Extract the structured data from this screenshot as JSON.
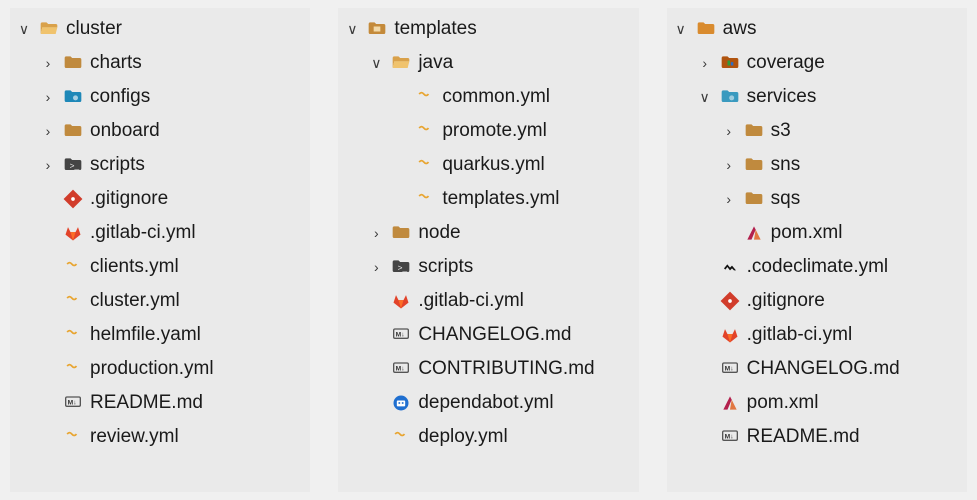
{
  "panels": [
    {
      "items": [
        {
          "indent": 0,
          "chev": "down",
          "icon": "folder-open",
          "label": "cluster"
        },
        {
          "indent": 1,
          "chev": "right",
          "icon": "folder",
          "label": "charts"
        },
        {
          "indent": 1,
          "chev": "right",
          "icon": "folder-config",
          "label": "configs"
        },
        {
          "indent": 1,
          "chev": "right",
          "icon": "folder",
          "label": "onboard"
        },
        {
          "indent": 1,
          "chev": "right",
          "icon": "folder-scripts",
          "label": "scripts"
        },
        {
          "indent": 1,
          "chev": "none",
          "icon": "gitignore",
          "label": ".gitignore"
        },
        {
          "indent": 1,
          "chev": "none",
          "icon": "gitlab",
          "label": ".gitlab-ci.yml"
        },
        {
          "indent": 1,
          "chev": "none",
          "icon": "yml",
          "label": "clients.yml"
        },
        {
          "indent": 1,
          "chev": "none",
          "icon": "yml",
          "label": "cluster.yml"
        },
        {
          "indent": 1,
          "chev": "none",
          "icon": "yml",
          "label": "helmfile.yaml"
        },
        {
          "indent": 1,
          "chev": "none",
          "icon": "yml",
          "label": "production.yml"
        },
        {
          "indent": 1,
          "chev": "none",
          "icon": "md",
          "label": "README.md"
        },
        {
          "indent": 1,
          "chev": "none",
          "icon": "yml",
          "label": "review.yml"
        }
      ]
    },
    {
      "items": [
        {
          "indent": 0,
          "chev": "down",
          "icon": "folder-templates",
          "label": "templates"
        },
        {
          "indent": 1,
          "chev": "down",
          "icon": "folder-open",
          "label": "java"
        },
        {
          "indent": 2,
          "chev": "none",
          "icon": "yml",
          "label": "common.yml"
        },
        {
          "indent": 2,
          "chev": "none",
          "icon": "yml",
          "label": "promote.yml"
        },
        {
          "indent": 2,
          "chev": "none",
          "icon": "yml",
          "label": "quarkus.yml"
        },
        {
          "indent": 2,
          "chev": "none",
          "icon": "yml",
          "label": "templates.yml"
        },
        {
          "indent": 1,
          "chev": "right",
          "icon": "folder",
          "label": "node"
        },
        {
          "indent": 1,
          "chev": "right",
          "icon": "folder-scripts",
          "label": "scripts"
        },
        {
          "indent": 1,
          "chev": "none",
          "icon": "gitlab",
          "label": ".gitlab-ci.yml"
        },
        {
          "indent": 1,
          "chev": "none",
          "icon": "md",
          "label": "CHANGELOG.md"
        },
        {
          "indent": 1,
          "chev": "none",
          "icon": "md",
          "label": "CONTRIBUTING.md"
        },
        {
          "indent": 1,
          "chev": "none",
          "icon": "dependabot",
          "label": "dependabot.yml"
        },
        {
          "indent": 1,
          "chev": "none",
          "icon": "yml",
          "label": "deploy.yml"
        }
      ]
    },
    {
      "items": [
        {
          "indent": 0,
          "chev": "down",
          "icon": "folder-aws",
          "label": "aws"
        },
        {
          "indent": 1,
          "chev": "right",
          "icon": "folder-coverage",
          "label": "coverage"
        },
        {
          "indent": 1,
          "chev": "down",
          "icon": "folder-services",
          "label": "services"
        },
        {
          "indent": 2,
          "chev": "right",
          "icon": "folder",
          "label": "s3"
        },
        {
          "indent": 2,
          "chev": "right",
          "icon": "folder",
          "label": "sns"
        },
        {
          "indent": 2,
          "chev": "right",
          "icon": "folder",
          "label": "sqs"
        },
        {
          "indent": 2,
          "chev": "none",
          "icon": "maven",
          "label": "pom.xml"
        },
        {
          "indent": 1,
          "chev": "none",
          "icon": "codeclimate",
          "label": ".codeclimate.yml"
        },
        {
          "indent": 1,
          "chev": "none",
          "icon": "gitignore",
          "label": ".gitignore"
        },
        {
          "indent": 1,
          "chev": "none",
          "icon": "gitlab",
          "label": ".gitlab-ci.yml"
        },
        {
          "indent": 1,
          "chev": "none",
          "icon": "md",
          "label": "CHANGELOG.md"
        },
        {
          "indent": 1,
          "chev": "none",
          "icon": "maven",
          "label": "pom.xml"
        },
        {
          "indent": 1,
          "chev": "none",
          "icon": "md",
          "label": "README.md"
        }
      ]
    }
  ]
}
